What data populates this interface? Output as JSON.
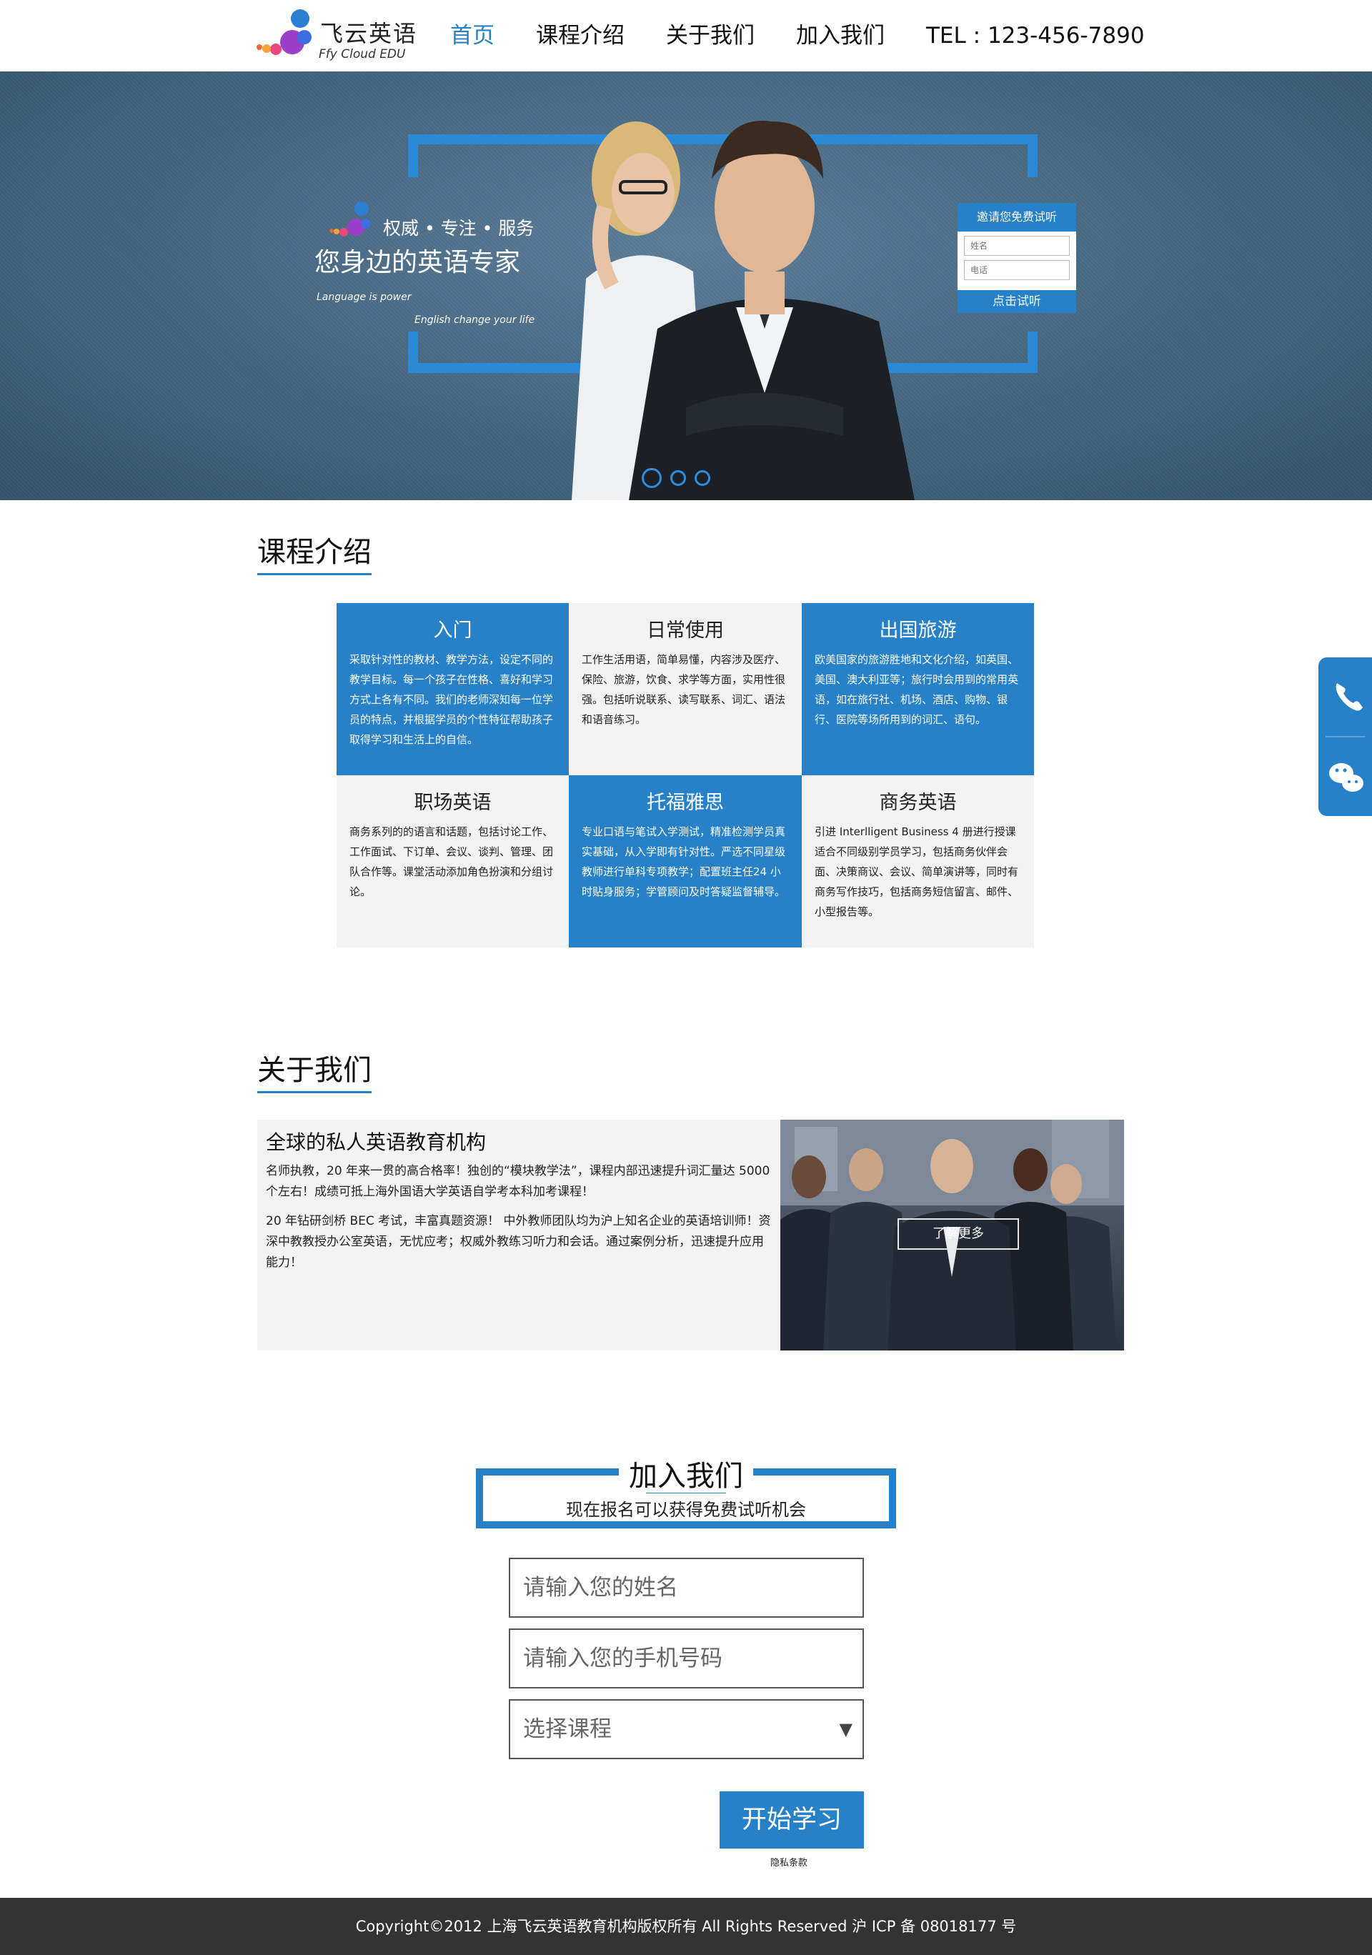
{
  "header": {
    "logo_cn": "飞云英语",
    "logo_en": "Ffy Cloud EDU",
    "nav": [
      {
        "label": "首页",
        "active": true
      },
      {
        "label": "课程介绍",
        "active": false
      },
      {
        "label": "关于我们",
        "active": false
      },
      {
        "label": "加入我们",
        "active": false
      }
    ],
    "tel": "TEL : 123-456-7890"
  },
  "banner": {
    "tagline": "权威 • 专注 • 服务",
    "headline": "您身边的英语专家",
    "line1": "Language is power",
    "line2": "English change your life",
    "trial": {
      "title": "邀请您免费试听",
      "name_placeholder": "姓名",
      "phone_placeholder": "电话",
      "button": "点击试听"
    }
  },
  "courses": {
    "title": "课程介绍",
    "items": [
      {
        "title": "入门",
        "text": "采取针对性的教材、教学方法，设定不同的教学目标。每一个孩子在性格、喜好和学习方式上各有不同。我们的老师深知每一位学员的特点，并根据学员的个性特征帮助孩子取得学习和生活上的自信。",
        "theme": "blue"
      },
      {
        "title": "日常使用",
        "text": "工作生活用语，简单易懂，内容涉及医疗、保险、旅游，饮食、求学等方面，实用性很强。包括听说联系、读写联系、词汇、语法和语音练习。",
        "theme": "gray"
      },
      {
        "title": "出国旅游",
        "text": "欧美国家的旅游胜地和文化介绍，如英国、美国、澳大利亚等；旅行时会用到的常用英语，如在旅行社、机场、酒店、购物、银行、医院等场所用到的词汇、语句。",
        "theme": "blue"
      },
      {
        "title": "职场英语",
        "text": "商务系列的的语言和话题，包括讨论工作、工作面试、下订单、会议、谈判、管理、团队合作等。课堂活动添加角色扮演和分组讨论。",
        "theme": "gray"
      },
      {
        "title": "托福雅思",
        "text": "专业口语与笔试入学测试，精准检测学员真实基础，从入学即有针对性。严选不同星级教师进行单科专项教学；配置班主任24 小时贴身服务；学管顾问及时答疑监督辅导。",
        "theme": "blue"
      },
      {
        "title": "商务英语",
        "text": "引进 Interlligent Business 4 册进行授课适合不同级别学员学习，包括商务伙伴会面、决策商议、会议、简单演讲等，同时有商务写作技巧，包括商务短信留言、邮件、小型报告等。",
        "theme": "gray"
      }
    ]
  },
  "about": {
    "title": "关于我们",
    "heading": "全球的私人英语教育机构",
    "p1": "名师执教，20 年来一贯的高合格率！独创的“模块教学法”，课程内部迅速提升词汇量达 5000 个左右！成绩可抵上海外国语大学英语自学考本科加考课程！",
    "p2": "20 年钻研剑桥 BEC 考试，丰富真题资源！ 中外教师团队均为沪上知名企业的英语培训师！资深中教教授办公室英语，无忧应考；权威外教练习听力和会话。通过案例分析，迅速提升应用能力！",
    "more": "了解更多"
  },
  "join": {
    "title": "加入我们",
    "subtitle": "现在报名可以获得免费试听机会",
    "name_placeholder": "请输入您的姓名",
    "phone_placeholder": "请输入您的手机号码",
    "course_select": "选择课程",
    "button": "开始学习",
    "privacy": "隐私条款"
  },
  "footer": {
    "copyright": "Copyright©2012 上海飞云英语教育机构版权所有 All Rights Reserved 沪 ICP 备 08018177 号"
  },
  "colors": {
    "accent": "#2781c8",
    "footer": "#333333",
    "panel": "#f3f3f3"
  },
  "icons": [
    "phone-icon",
    "wechat-icon"
  ]
}
